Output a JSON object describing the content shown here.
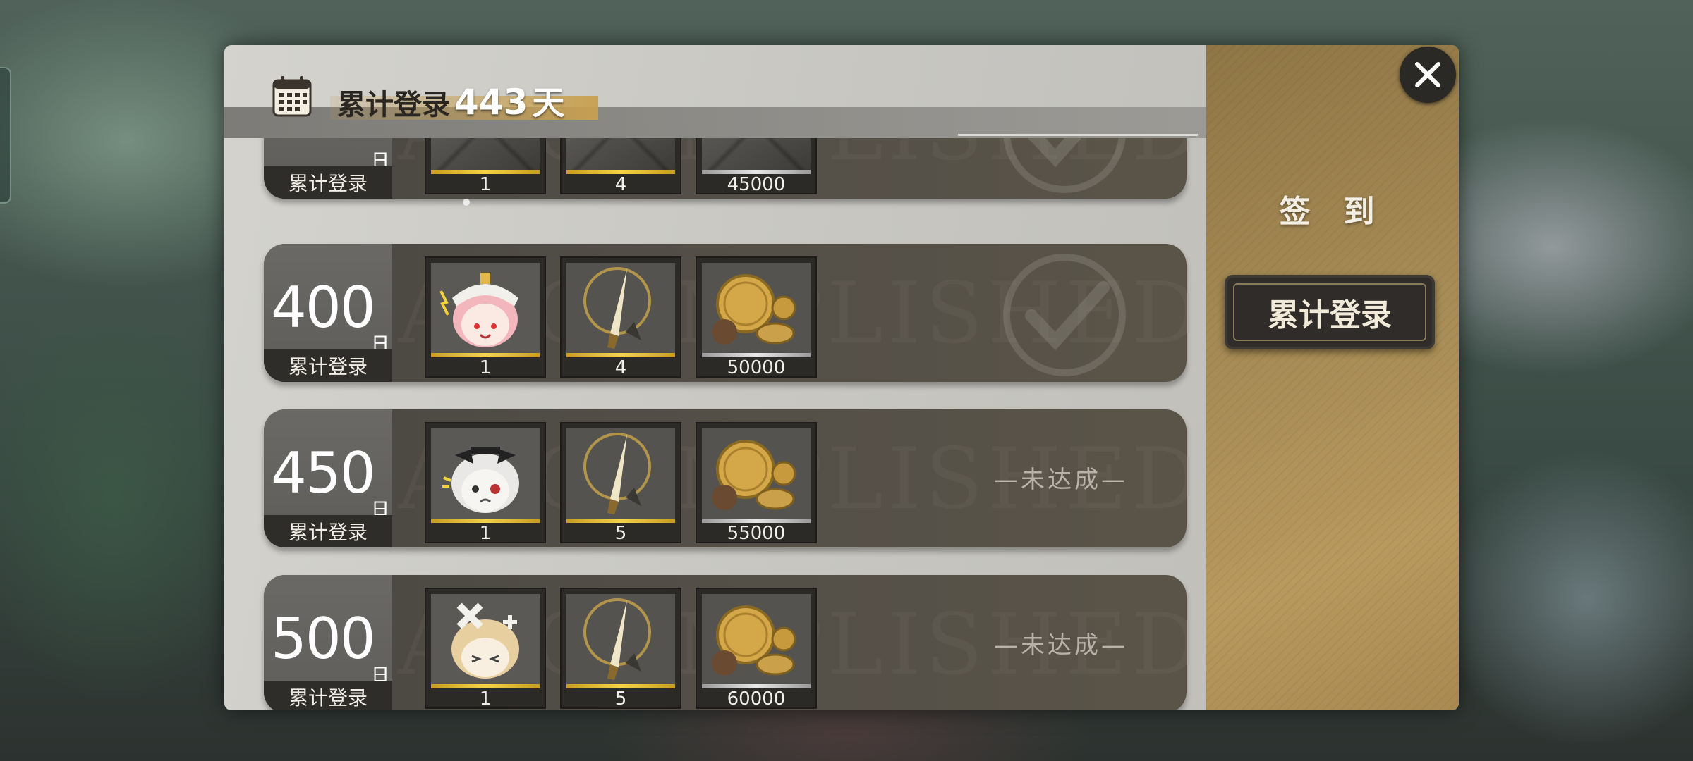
{
  "header": {
    "title_prefix": "累计登录",
    "days": "443",
    "days_unit": "天",
    "icon": "calendar-icon"
  },
  "side_tabs": {
    "sign_in": "签 到",
    "cumulative_login": "累计登录"
  },
  "close_icon": "close-icon",
  "watermark": "ACCOMPLISHED",
  "rows": [
    {
      "day": "",
      "day_unit": "日",
      "label": "累计登录",
      "status": "claimed",
      "status_text": "",
      "items": [
        {
          "icon": "character-token-icon",
          "count": "1"
        },
        {
          "icon": "blade-icon",
          "count": "4"
        },
        {
          "icon": "coins-icon",
          "count": "45000"
        }
      ]
    },
    {
      "day": "400",
      "day_unit": "日",
      "label": "累计登录",
      "status": "claimed",
      "status_text": "",
      "items": [
        {
          "icon": "pink-hair-character-icon",
          "count": "1"
        },
        {
          "icon": "blade-icon",
          "count": "4"
        },
        {
          "icon": "coins-icon",
          "count": "50000"
        }
      ]
    },
    {
      "day": "450",
      "day_unit": "日",
      "label": "累计登录",
      "status": "locked",
      "status_text": "—未达成—",
      "items": [
        {
          "icon": "white-hair-character-icon",
          "count": "1"
        },
        {
          "icon": "blade-icon",
          "count": "5"
        },
        {
          "icon": "coins-icon",
          "count": "55000"
        }
      ]
    },
    {
      "day": "500",
      "day_unit": "日",
      "label": "累计登录",
      "status": "locked",
      "status_text": "—未达成—",
      "items": [
        {
          "icon": "blonde-character-icon",
          "count": "1"
        },
        {
          "icon": "blade-icon",
          "count": "5"
        },
        {
          "icon": "coins-icon",
          "count": "60000"
        }
      ]
    }
  ],
  "colors": {
    "gold_bar": "#f4d34a",
    "side_panel": "#a58a54",
    "row_bg": "#4a4742"
  }
}
